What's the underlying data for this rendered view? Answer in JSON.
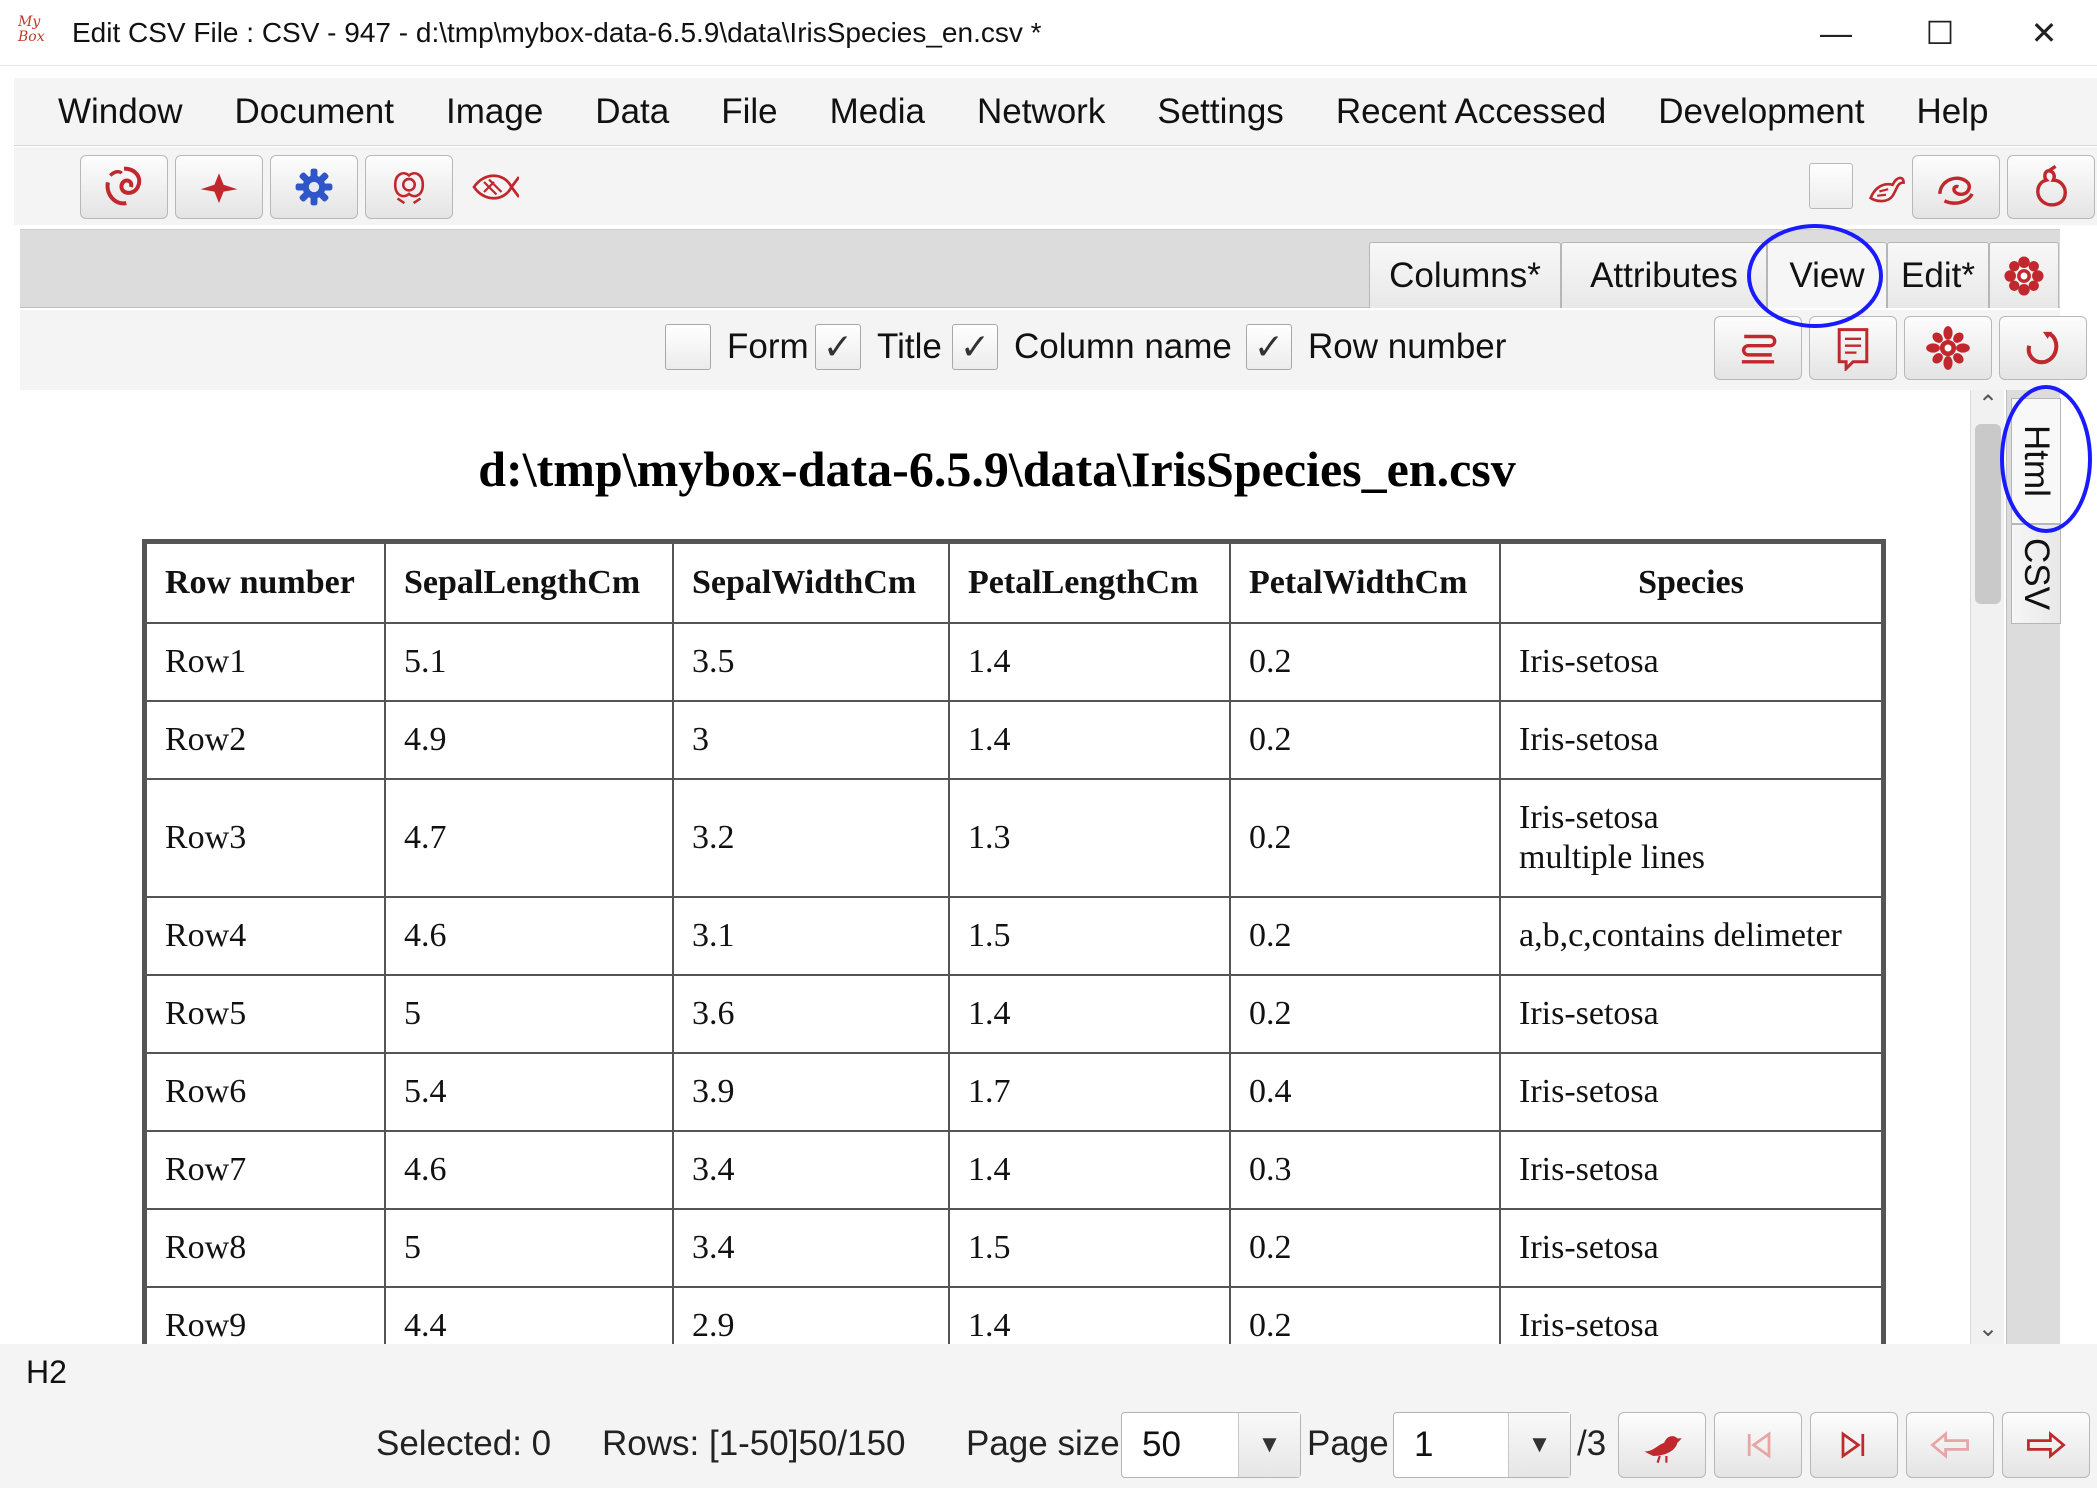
{
  "window": {
    "app_logo_text": "My Box",
    "title": "Edit CSV File : CSV - 947 - d:\\tmp\\mybox-data-6.5.9\\data\\IrisSpecies_en.csv *",
    "minimize_glyph": "—",
    "maximize_glyph": "☐",
    "close_glyph": "✕"
  },
  "menu": [
    "Window",
    "Document",
    "Image",
    "Data",
    "File",
    "Media",
    "Network",
    "Settings",
    "Recent Accessed",
    "Development",
    "Help"
  ],
  "toolbar": {
    "left_icons": [
      "swirl-logo-icon",
      "bird-icon",
      "gear-icon",
      "peony-flower-icon",
      "fish-icon"
    ],
    "right_icons": [
      "phoenix-icon",
      "cloud-swirl-icon",
      "gourd-icon"
    ],
    "accent_color": "#c0282d"
  },
  "tabs": {
    "items": [
      "Columns*",
      "Attributes",
      "View",
      "Edit*"
    ],
    "active": "View",
    "menu_icon": "flower-menu-icon"
  },
  "options": {
    "form": {
      "label": "Form",
      "checked": false
    },
    "title": {
      "label": "Title",
      "checked": true
    },
    "column_name": {
      "label": "Column name",
      "checked": true
    },
    "row_number": {
      "label": "Row number",
      "checked": true
    },
    "check_glyph": "✓",
    "right_icons": [
      "snake-icon",
      "document-icon",
      "flower-icon",
      "refresh-icon"
    ]
  },
  "view": {
    "heading": "d:\\tmp\\mybox-data-6.5.9\\data\\IrisSpecies_en.csv",
    "columns": [
      "Row number",
      "SepalLengthCm",
      "SepalWidthCm",
      "PetalLengthCm",
      "PetalWidthCm",
      "Species"
    ],
    "rows": [
      [
        "Row1",
        "5.1",
        "3.5",
        "1.4",
        "0.2",
        "Iris-setosa"
      ],
      [
        "Row2",
        "4.9",
        "3",
        "1.4",
        "0.2",
        "Iris-setosa"
      ],
      [
        "Row3",
        "4.7",
        "3.2",
        "1.3",
        "0.2",
        "Iris-setosa\nmultiple lines"
      ],
      [
        "Row4",
        "4.6",
        "3.1",
        "1.5",
        "0.2",
        "a,b,c,contains delimeter"
      ],
      [
        "Row5",
        "5",
        "3.6",
        "1.4",
        "0.2",
        "Iris-setosa"
      ],
      [
        "Row6",
        "5.4",
        "3.9",
        "1.7",
        "0.4",
        "Iris-setosa"
      ],
      [
        "Row7",
        "4.6",
        "3.4",
        "1.4",
        "0.3",
        "Iris-setosa"
      ],
      [
        "Row8",
        "5",
        "3.4",
        "1.5",
        "0.2",
        "Iris-setosa"
      ],
      [
        "Row9",
        "4.4",
        "2.9",
        "1.4",
        "0.2",
        "Iris-setosa"
      ]
    ]
  },
  "side_tabs": [
    "Html",
    "CSV"
  ],
  "status": {
    "text": "H2"
  },
  "bottom": {
    "selected": "Selected: 0",
    "rows": "Rows: [1-50]50/150",
    "page_size_label": "Page size",
    "page_size_value": "50",
    "page_label": "Page",
    "page_value": "1",
    "page_total": "/3",
    "nav_icons": [
      "bird-jump-icon",
      "first-page-icon",
      "last-page-icon",
      "previous-page-icon",
      "next-page-icon"
    ]
  },
  "annotation_color": "#1a1aff"
}
